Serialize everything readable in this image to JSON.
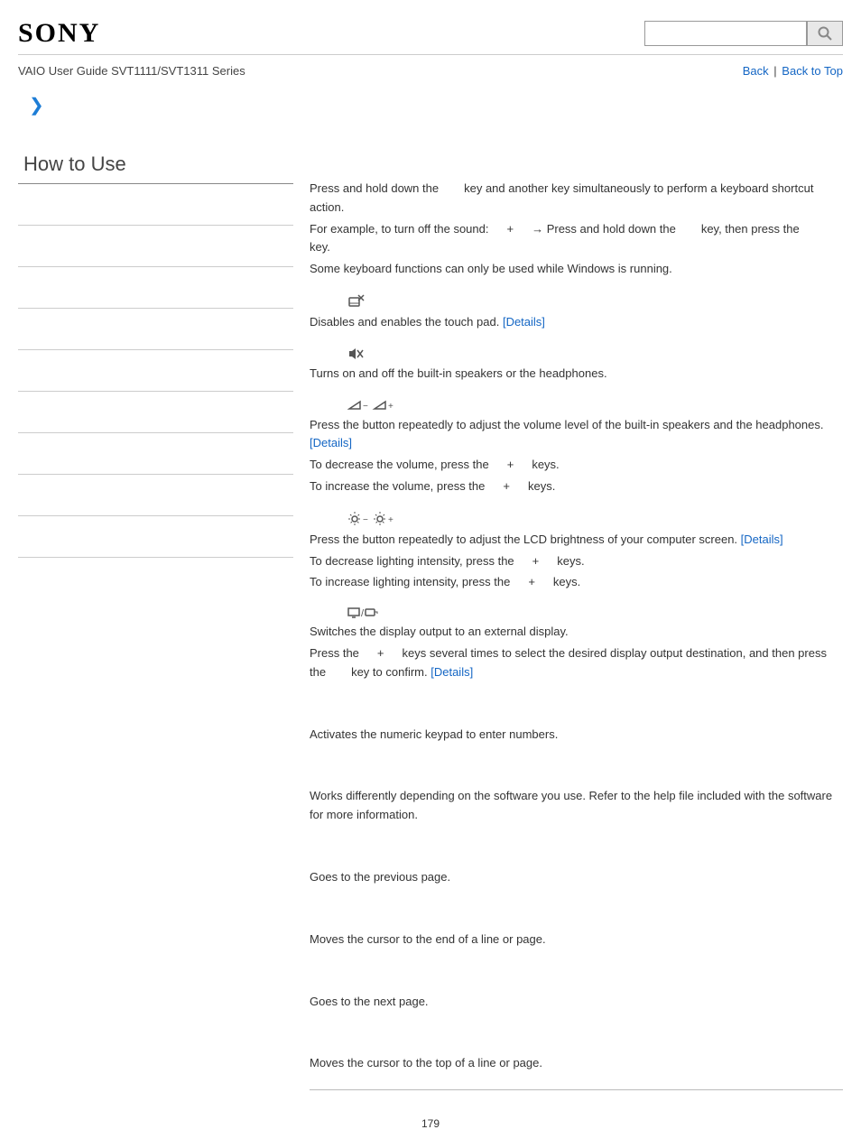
{
  "header": {
    "logo_text": "SONY",
    "search_placeholder": ""
  },
  "subheader": {
    "guide_title": "VAIO User Guide SVT1111/SVT1311 Series",
    "back_link": "Back",
    "back_to_top_link": "Back to Top",
    "separator": "|"
  },
  "sidebar": {
    "title": "How to Use"
  },
  "intro": {
    "line1a": "Press and hold down the",
    "line1b": "key and another key simultaneously to perform a keyboard shortcut action.",
    "line2a": "For example, to turn off the sound:",
    "line2b": "+",
    "line2c": "→ Press and hold down the",
    "line2d": "key, then press the",
    "line2e": "key.",
    "line3": "Some keyboard functions can only be used while Windows is running."
  },
  "sections": {
    "touchpad": {
      "text": "Disables and enables the touch pad.",
      "details": "[Details]"
    },
    "speakers": {
      "text": "Turns on and off the built-in speakers or the headphones."
    },
    "volume": {
      "text1": "Press the button repeatedly to adjust the volume level of the built-in speakers and the headphones.",
      "details": "[Details]",
      "text2a": "To decrease the volume, press the",
      "text2b": "+",
      "text2c": "keys.",
      "text3a": "To increase the volume, press the",
      "text3b": "+",
      "text3c": "keys."
    },
    "brightness": {
      "text1": "Press the button repeatedly to adjust the LCD brightness of your computer screen.",
      "details": "[Details]",
      "text2a": "To decrease lighting intensity, press the",
      "text2b": "+",
      "text2c": "keys.",
      "text3a": "To increase lighting intensity, press the",
      "text3b": "+",
      "text3c": "keys."
    },
    "display": {
      "text1": "Switches the display output to an external display.",
      "text2a": "Press the",
      "text2b": "+",
      "text2c": "keys several times to select the desired display output destination, and then press the",
      "text2d": "key to confirm.",
      "details": "[Details]"
    },
    "numpad": {
      "text": "Activates the numeric keypad to enter numbers."
    },
    "software": {
      "text": "Works differently depending on the software you use. Refer to the help file included with the software for more information."
    },
    "prevpage": {
      "text": "Goes to the previous page."
    },
    "endline": {
      "text": "Moves the cursor to the end of a line or page."
    },
    "nextpage": {
      "text": "Goes to the next page."
    },
    "topline": {
      "text": "Moves the cursor to the top of a line or page."
    }
  },
  "page_number": "179"
}
